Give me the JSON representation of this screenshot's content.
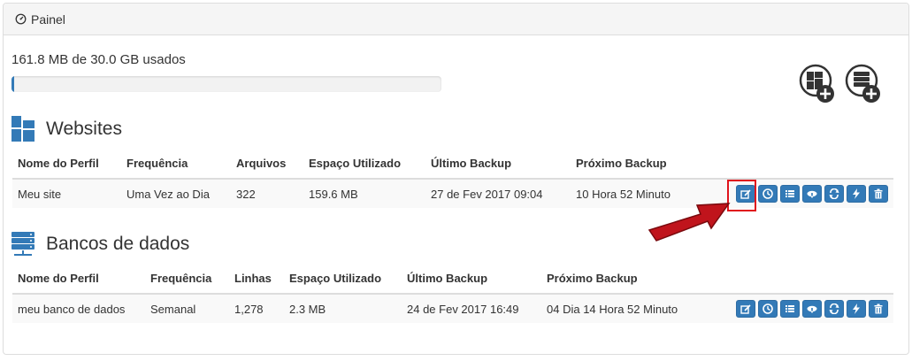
{
  "panel": {
    "title": "Painel",
    "icon": "dashboard-icon"
  },
  "usage": {
    "text": "161.8 MB de 30.0 GB usados",
    "fraction": 0.0053,
    "color": "#337ab7"
  },
  "toolbar": {
    "add_website_icon": "add-website-icon",
    "add_database_icon": "add-database-icon"
  },
  "websites": {
    "title": "Websites",
    "headers": [
      "Nome do Perfil",
      "Frequência",
      "Arquivos",
      "Espaço Utilizado",
      "Último Backup",
      "Próximo Backup"
    ],
    "rows": [
      [
        "Meu site",
        "Uma Vez ao Dia",
        "322",
        "159.6 MB",
        "27 de Fev 2017 09:04",
        "10 Hora 52 Minuto"
      ]
    ]
  },
  "databases": {
    "title": "Bancos de dados",
    "headers": [
      "Nome do Perfil",
      "Frequência",
      "Linhas",
      "Espaço Utilizado",
      "Último Backup",
      "Próximo Backup"
    ],
    "rows": [
      [
        "meu banco de dados",
        "Semanal",
        "1,278",
        "2.3 MB",
        "24 de Fev 2017 16:49",
        "04 Dia 14 Hora 52 Minuto"
      ]
    ]
  },
  "actions": [
    "edit-icon",
    "clock-icon",
    "list-icon",
    "cloud-download-icon",
    "refresh-icon",
    "bolt-icon",
    "trash-icon"
  ],
  "colors": {
    "accent": "#337ab7",
    "highlight": "#e0141c",
    "arrow": "#c0141c"
  }
}
